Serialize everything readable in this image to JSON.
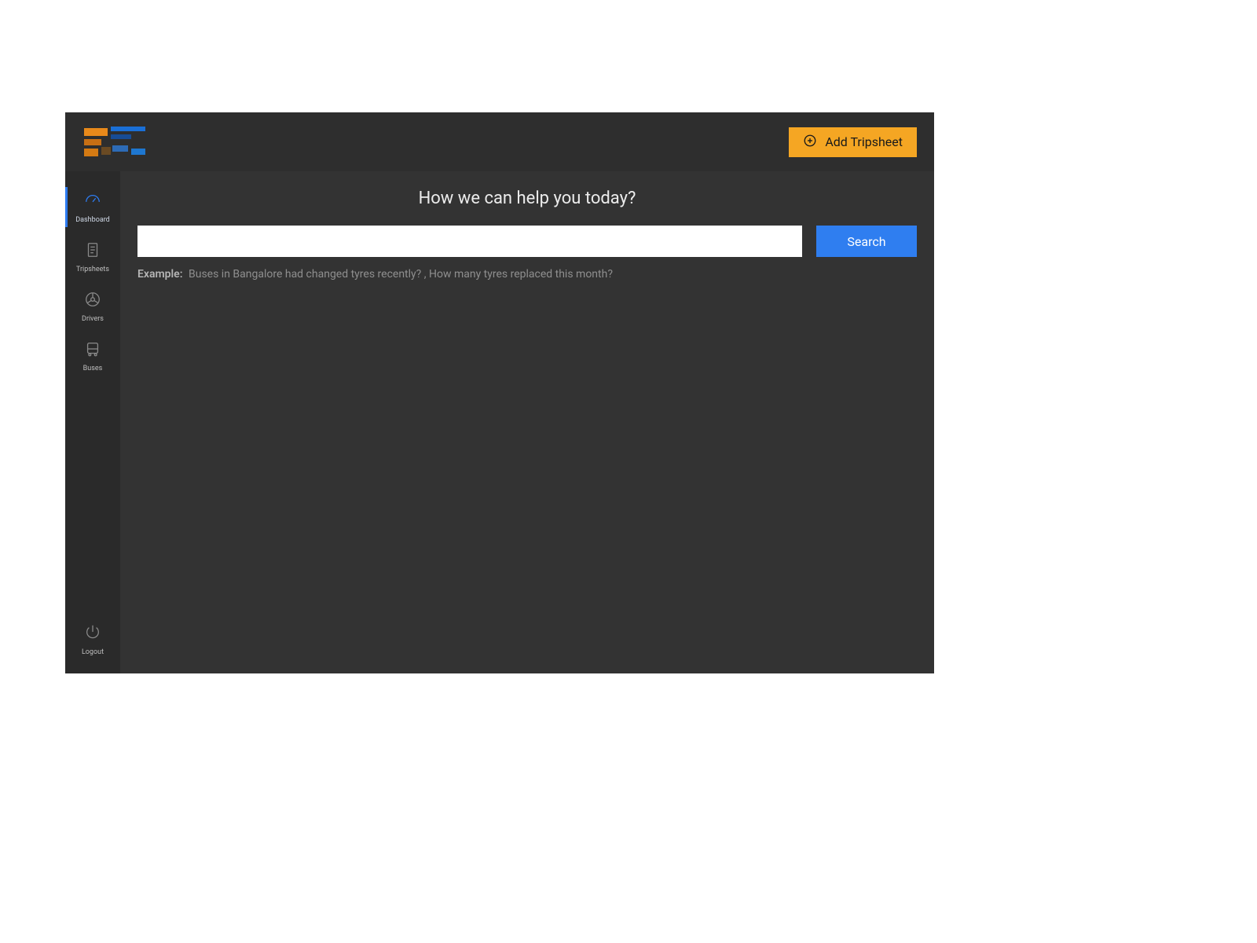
{
  "topbar": {
    "add_button_label": "Add Tripsheet"
  },
  "sidebar": {
    "items": [
      {
        "label": "Dashboard"
      },
      {
        "label": "Tripsheets"
      },
      {
        "label": "Drivers"
      },
      {
        "label": "Buses"
      }
    ],
    "logout_label": "Logout"
  },
  "main": {
    "headline": "How we can help you today?",
    "search_value": "",
    "search_button_label": "Search",
    "example_label": "Example:",
    "example_text": "Buses in Bangalore had changed tyres recently? , How many tyres replaced this month?"
  }
}
